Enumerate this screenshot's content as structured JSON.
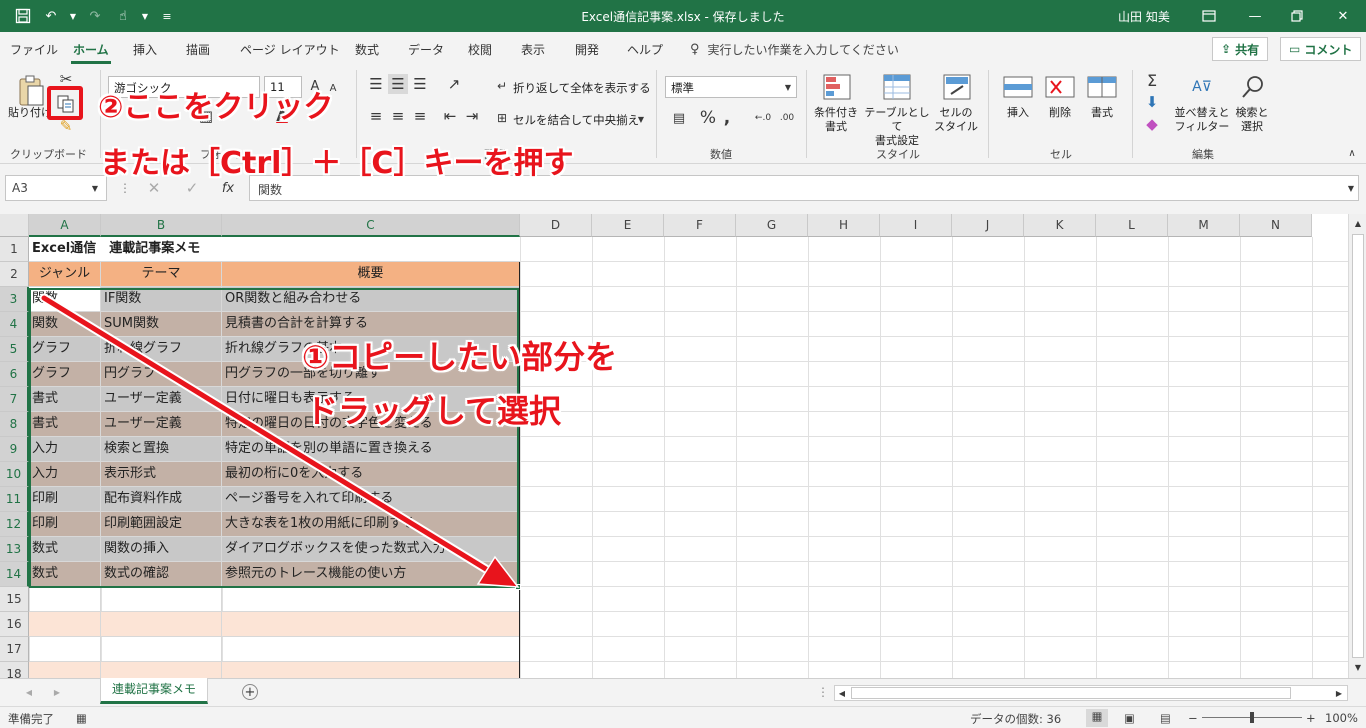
{
  "titlebar": {
    "title": "Excel通信記事案.xlsx  -  保存しました",
    "user": "山田 知美",
    "qat_icons": [
      "save-icon",
      "undo-icon",
      "redo-icon",
      "touch-mode-icon",
      "customize-icon"
    ]
  },
  "tabs": [
    "ファイル",
    "ホーム",
    "挿入",
    "描画",
    "ページ レイアウト",
    "数式",
    "データ",
    "校閲",
    "表示",
    "開発",
    "ヘルプ"
  ],
  "tellme": "実行したい作業を入力してください",
  "share_label": "共有",
  "comment_label": "コメント",
  "ribbon": {
    "paste_label": "貼り付け",
    "font_name": "游ゴシック",
    "font_size": "11",
    "wrap_label": "折り返して全体を表示する",
    "merge_label": "セルを結合して中央揃え",
    "number_format": "標準",
    "cond_format": [
      "条件付き",
      "書式"
    ],
    "table_format": [
      "テーブルとして",
      "書式設定"
    ],
    "cell_style": [
      "セルの",
      "スタイル"
    ],
    "insert_label": "挿入",
    "delete_label": "削除",
    "format_label": "書式",
    "sort_label": [
      "並べ替えと",
      "フィルター"
    ],
    "find_label": [
      "検索と",
      "選択"
    ],
    "groups": {
      "clipboard": "クリップボード",
      "font": "フォント",
      "alignment": "配置",
      "number": "数値",
      "style": "スタイル",
      "cells": "セル",
      "edit": "編集"
    }
  },
  "formula_bar": {
    "name_box": "A3",
    "formula": "関数"
  },
  "columns": [
    "A",
    "B",
    "C",
    "D",
    "E",
    "F",
    "G",
    "H",
    "I",
    "J",
    "K",
    "L",
    "M",
    "N"
  ],
  "rows": [
    "1",
    "2",
    "3",
    "4",
    "5",
    "6",
    "7",
    "8",
    "9",
    "10",
    "11",
    "12",
    "13",
    "14",
    "15",
    "16",
    "17",
    "18"
  ],
  "sheet": {
    "title": "Excel通信　連載記事案メモ",
    "headers": [
      "ジャンル",
      "テーマ",
      "概要"
    ],
    "data": [
      [
        "関数",
        "IF関数",
        "OR関数と組み合わせる"
      ],
      [
        "関数",
        "SUM関数",
        "見積書の合計を計算する"
      ],
      [
        "グラフ",
        "折れ線グラフ",
        "折れ線グラフの基本"
      ],
      [
        "グラフ",
        "円グラフ",
        "円グラフの一部を切り離す"
      ],
      [
        "書式",
        "ユーザー定義",
        "日付に曜日も表示する"
      ],
      [
        "書式",
        "ユーザー定義",
        "特定の曜日の日付の文字色を変える"
      ],
      [
        "入力",
        "検索と置換",
        "特定の単語を別の単語に置き換える"
      ],
      [
        "入力",
        "表示形式",
        "最初の桁に0を入力する"
      ],
      [
        "印刷",
        "配布資料作成",
        "ページ番号を入れて印刷する"
      ],
      [
        "印刷",
        "印刷範囲設定",
        "大きな表を1枚の用紙に印刷する"
      ],
      [
        "数式",
        "関数の挿入",
        "ダイアログボックスを使った数式入力"
      ],
      [
        "数式",
        "数式の確認",
        "参照元のトレース機能の使い方"
      ]
    ]
  },
  "sheet_tab": "連載記事案メモ",
  "status": {
    "ready": "準備完了",
    "count": "データの個数: 36",
    "zoom": "100%"
  },
  "annotations": {
    "step2_line1": "②ここをクリック",
    "step2_line2": "または［Ctrl］＋［C］キーを押す",
    "step1_line1": "①コピーしたい部分を",
    "step1_line2": "ドラッグして選択"
  },
  "colors": {
    "excel_green": "#217346",
    "header_orange": "#f4b183",
    "row_gray": "#c8c8c8",
    "row_brown": "#c3b1a6",
    "row_peach": "#fce4d6",
    "annotation_red": "#e8141c"
  }
}
